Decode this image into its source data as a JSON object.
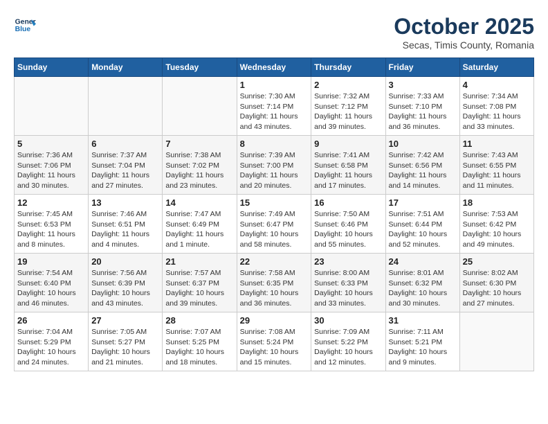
{
  "header": {
    "logo_line1": "General",
    "logo_line2": "Blue",
    "month_title": "October 2025",
    "location": "Secas, Timis County, Romania"
  },
  "days_of_week": [
    "Sunday",
    "Monday",
    "Tuesday",
    "Wednesday",
    "Thursday",
    "Friday",
    "Saturday"
  ],
  "weeks": [
    [
      {
        "day": "",
        "info": ""
      },
      {
        "day": "",
        "info": ""
      },
      {
        "day": "",
        "info": ""
      },
      {
        "day": "1",
        "info": "Sunrise: 7:30 AM\nSunset: 7:14 PM\nDaylight: 11 hours\nand 43 minutes."
      },
      {
        "day": "2",
        "info": "Sunrise: 7:32 AM\nSunset: 7:12 PM\nDaylight: 11 hours\nand 39 minutes."
      },
      {
        "day": "3",
        "info": "Sunrise: 7:33 AM\nSunset: 7:10 PM\nDaylight: 11 hours\nand 36 minutes."
      },
      {
        "day": "4",
        "info": "Sunrise: 7:34 AM\nSunset: 7:08 PM\nDaylight: 11 hours\nand 33 minutes."
      }
    ],
    [
      {
        "day": "5",
        "info": "Sunrise: 7:36 AM\nSunset: 7:06 PM\nDaylight: 11 hours\nand 30 minutes."
      },
      {
        "day": "6",
        "info": "Sunrise: 7:37 AM\nSunset: 7:04 PM\nDaylight: 11 hours\nand 27 minutes."
      },
      {
        "day": "7",
        "info": "Sunrise: 7:38 AM\nSunset: 7:02 PM\nDaylight: 11 hours\nand 23 minutes."
      },
      {
        "day": "8",
        "info": "Sunrise: 7:39 AM\nSunset: 7:00 PM\nDaylight: 11 hours\nand 20 minutes."
      },
      {
        "day": "9",
        "info": "Sunrise: 7:41 AM\nSunset: 6:58 PM\nDaylight: 11 hours\nand 17 minutes."
      },
      {
        "day": "10",
        "info": "Sunrise: 7:42 AM\nSunset: 6:56 PM\nDaylight: 11 hours\nand 14 minutes."
      },
      {
        "day": "11",
        "info": "Sunrise: 7:43 AM\nSunset: 6:55 PM\nDaylight: 11 hours\nand 11 minutes."
      }
    ],
    [
      {
        "day": "12",
        "info": "Sunrise: 7:45 AM\nSunset: 6:53 PM\nDaylight: 11 hours\nand 8 minutes."
      },
      {
        "day": "13",
        "info": "Sunrise: 7:46 AM\nSunset: 6:51 PM\nDaylight: 11 hours\nand 4 minutes."
      },
      {
        "day": "14",
        "info": "Sunrise: 7:47 AM\nSunset: 6:49 PM\nDaylight: 11 hours\nand 1 minute."
      },
      {
        "day": "15",
        "info": "Sunrise: 7:49 AM\nSunset: 6:47 PM\nDaylight: 10 hours\nand 58 minutes."
      },
      {
        "day": "16",
        "info": "Sunrise: 7:50 AM\nSunset: 6:46 PM\nDaylight: 10 hours\nand 55 minutes."
      },
      {
        "day": "17",
        "info": "Sunrise: 7:51 AM\nSunset: 6:44 PM\nDaylight: 10 hours\nand 52 minutes."
      },
      {
        "day": "18",
        "info": "Sunrise: 7:53 AM\nSunset: 6:42 PM\nDaylight: 10 hours\nand 49 minutes."
      }
    ],
    [
      {
        "day": "19",
        "info": "Sunrise: 7:54 AM\nSunset: 6:40 PM\nDaylight: 10 hours\nand 46 minutes."
      },
      {
        "day": "20",
        "info": "Sunrise: 7:56 AM\nSunset: 6:39 PM\nDaylight: 10 hours\nand 43 minutes."
      },
      {
        "day": "21",
        "info": "Sunrise: 7:57 AM\nSunset: 6:37 PM\nDaylight: 10 hours\nand 39 minutes."
      },
      {
        "day": "22",
        "info": "Sunrise: 7:58 AM\nSunset: 6:35 PM\nDaylight: 10 hours\nand 36 minutes."
      },
      {
        "day": "23",
        "info": "Sunrise: 8:00 AM\nSunset: 6:33 PM\nDaylight: 10 hours\nand 33 minutes."
      },
      {
        "day": "24",
        "info": "Sunrise: 8:01 AM\nSunset: 6:32 PM\nDaylight: 10 hours\nand 30 minutes."
      },
      {
        "day": "25",
        "info": "Sunrise: 8:02 AM\nSunset: 6:30 PM\nDaylight: 10 hours\nand 27 minutes."
      }
    ],
    [
      {
        "day": "26",
        "info": "Sunrise: 7:04 AM\nSunset: 5:29 PM\nDaylight: 10 hours\nand 24 minutes."
      },
      {
        "day": "27",
        "info": "Sunrise: 7:05 AM\nSunset: 5:27 PM\nDaylight: 10 hours\nand 21 minutes."
      },
      {
        "day": "28",
        "info": "Sunrise: 7:07 AM\nSunset: 5:25 PM\nDaylight: 10 hours\nand 18 minutes."
      },
      {
        "day": "29",
        "info": "Sunrise: 7:08 AM\nSunset: 5:24 PM\nDaylight: 10 hours\nand 15 minutes."
      },
      {
        "day": "30",
        "info": "Sunrise: 7:09 AM\nSunset: 5:22 PM\nDaylight: 10 hours\nand 12 minutes."
      },
      {
        "day": "31",
        "info": "Sunrise: 7:11 AM\nSunset: 5:21 PM\nDaylight: 10 hours\nand 9 minutes."
      },
      {
        "day": "",
        "info": ""
      }
    ]
  ]
}
